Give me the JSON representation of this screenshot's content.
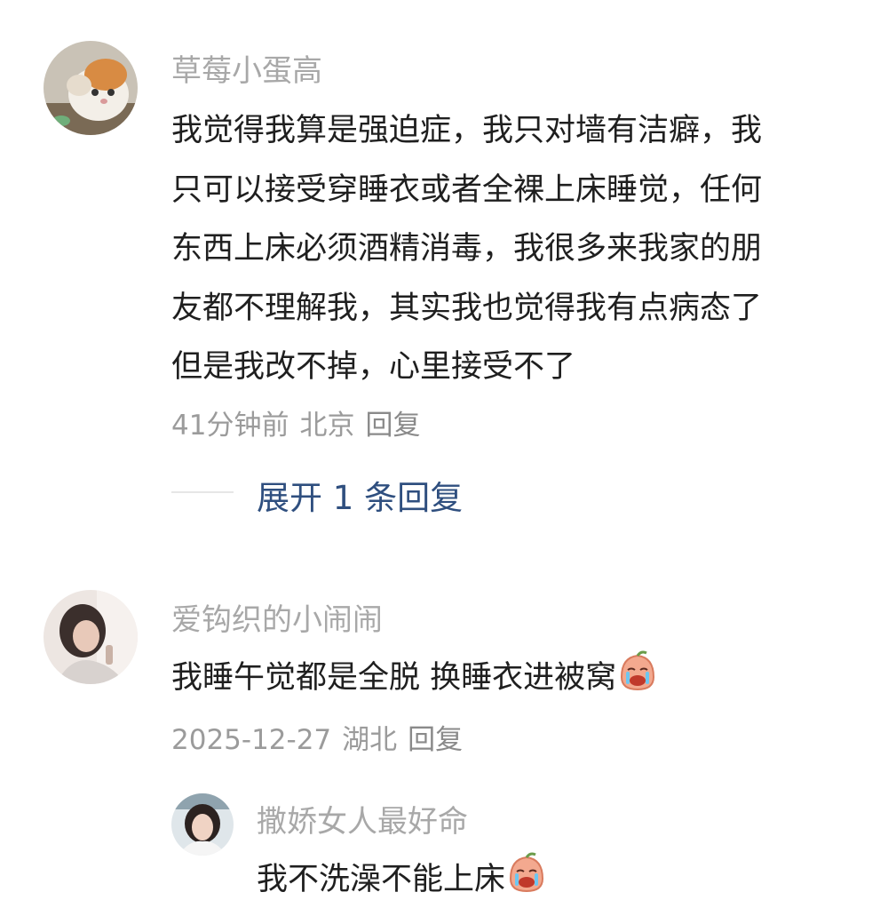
{
  "comments": [
    {
      "username": "草莓小蛋高",
      "text_lines": [
        "我觉得我算是强迫症，我只对墙有洁癖，我",
        "只可以接受穿睡衣或者全裸上床睡觉，任何",
        "东西上床必须酒精消毒，我很多来我家的朋",
        "友都不理解我，其实我也觉得我有点病态了",
        "但是我改不掉，心里接受不了"
      ],
      "time": "41分钟前",
      "location": "北京",
      "reply_label": "回复",
      "expand_label": "展开 1 条回复",
      "avatar": "cat-avatar"
    },
    {
      "username": "爱钩织的小闹闹",
      "text": "我睡午觉都是全脱 换睡衣进被窝",
      "emoji": "crying-face-emoji",
      "time": "2025-12-27",
      "location": "湖北",
      "reply_label": "回复",
      "avatar": "girl-portrait-avatar",
      "replies": [
        {
          "username": "撒娇女人最好命",
          "text": "我不洗澡不能上床",
          "emoji": "crying-face-emoji",
          "avatar": "woman-portrait-avatar"
        }
      ]
    }
  ]
}
